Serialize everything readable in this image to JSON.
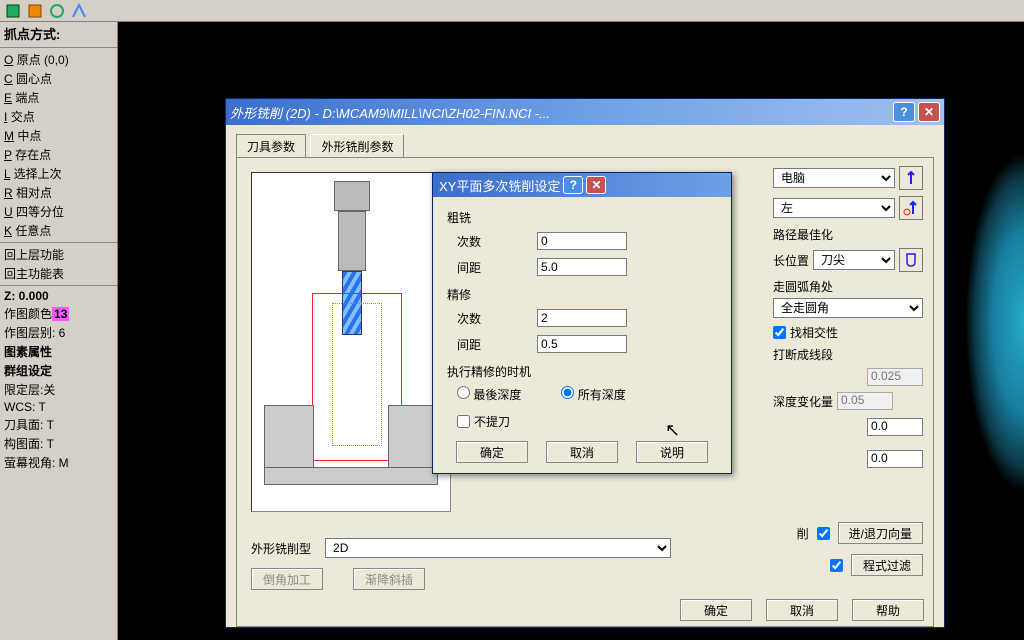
{
  "toolbar_label": "抓点方式:",
  "left_panel": {
    "title": "抓点方式:",
    "snap_items": [
      {
        "mn": "O",
        "lab": "原点 (0,0)"
      },
      {
        "mn": "C",
        "lab": "圆心点"
      },
      {
        "mn": "E",
        "lab": "端点"
      },
      {
        "mn": "I",
        "lab": "交点"
      },
      {
        "mn": "M",
        "lab": "中点"
      },
      {
        "mn": "P",
        "lab": "存在点"
      },
      {
        "mn": "L",
        "lab": "选择上次"
      },
      {
        "mn": "R",
        "lab": "相对点"
      },
      {
        "mn": "U",
        "lab": "四等分位"
      },
      {
        "mn": "K",
        "lab": "任意点"
      }
    ],
    "funcs": [
      "回上层功能",
      "回主功能表"
    ],
    "status": {
      "z": "Z:  0.000",
      "color_lab": "作图颜色",
      "color_val": "13",
      "layer": "作图层别: 6",
      "elem": "图素属性",
      "group": "群组设定",
      "limit": "限定层:关",
      "wcs": "WCS:  T",
      "toolface": "刀具面: T",
      "consface": "构图面: T",
      "screen": "萤幕视角: M"
    }
  },
  "main_dialog": {
    "title": "外形铣削 (2D) - D:\\MCAM9\\MILL\\NCI\\ZH02-FIN.NCI -...",
    "tabs": [
      "刀具参数",
      "外形铣削参数"
    ],
    "active_tab": 1,
    "right": {
      "sel1": "电脑",
      "sel2": "左",
      "opt_path": "路径最佳化",
      "sel3_label": "长位置",
      "sel3": "刀尖",
      "arc_lab": "走圆弧角处",
      "sel4": "全走圆角",
      "chk_inter": "找相交性",
      "chk_seg": "打断成线段",
      "in_seg": "0.025",
      "chk_depth": "深度变化量",
      "in_depth": "0.05",
      "in_a": "0.0",
      "in_b": "0.0"
    },
    "bottom": {
      "type_label": "外形铣削型",
      "type_sel": "2D",
      "btn_corner": "倒角加工",
      "btn_ramp": "渐降斜插",
      "chk_lead": "进/退刀向量",
      "chk_filter": "程式过滤",
      "part_cut": "削"
    },
    "buttons": {
      "ok": "确定",
      "cancel": "取消",
      "help": "帮助"
    }
  },
  "sub_dialog": {
    "title": "XY平面多次铣削设定",
    "rough_label": "粗铣",
    "rough_count_lab": "次数",
    "rough_count": "0",
    "rough_step_lab": "间距",
    "rough_step": "5.0",
    "finish_label": "精修",
    "finish_count_lab": "次数",
    "finish_count": "2",
    "finish_step_lab": "间距",
    "finish_step": "0.5",
    "timing_label": "执行精修的时机",
    "radio_final": "最後深度",
    "radio_all": "所有深度",
    "chk_keep": "不提刀",
    "ok": "确定",
    "cancel": "取消",
    "help": "说明"
  }
}
